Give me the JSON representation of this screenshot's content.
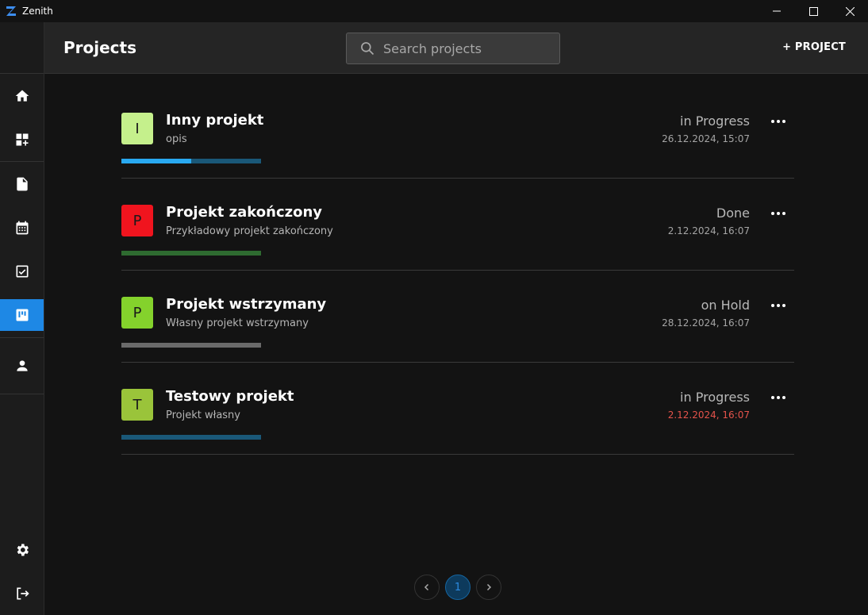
{
  "window": {
    "title": "Zenith"
  },
  "header": {
    "title": "Projects",
    "search_placeholder": "Search projects",
    "add_project_label": "+ PROJECT"
  },
  "sidebar": {
    "items": [
      {
        "name": "home",
        "icon": "home-icon"
      },
      {
        "name": "dashboard-add",
        "icon": "dashboard-add-icon"
      },
      {
        "name": "documents",
        "icon": "document-icon"
      },
      {
        "name": "calendar",
        "icon": "calendar-icon"
      },
      {
        "name": "tasks",
        "icon": "checkbox-icon"
      },
      {
        "name": "projects",
        "icon": "kanban-icon",
        "active": true
      },
      {
        "name": "profile",
        "icon": "person-icon"
      },
      {
        "name": "settings",
        "icon": "gear-icon"
      },
      {
        "name": "logout",
        "icon": "logout-icon"
      }
    ]
  },
  "projects": [
    {
      "initial": "I",
      "avatar_color": "#c5f08c",
      "name": "Inny projekt",
      "description": "opis",
      "status": "in Progress",
      "date": "26.12.2024, 15:07",
      "date_overdue": false,
      "progress": 0.5,
      "progress_color": "#29a9f0",
      "progress_track": "#1a5878"
    },
    {
      "initial": "P",
      "avatar_color": "#f0141e",
      "name": "Projekt zakończony",
      "description": "Przykładowy projekt zakończony",
      "status": "Done",
      "date": "2.12.2024, 16:07",
      "date_overdue": false,
      "progress": 1.0,
      "progress_color": "#2e6b30",
      "progress_track": "#2e6b30"
    },
    {
      "initial": "P",
      "avatar_color": "#84d22c",
      "name": "Projekt wstrzymany",
      "description": "Własny projekt wstrzymany",
      "status": "on Hold",
      "date": "28.12.2024, 16:07",
      "date_overdue": false,
      "progress": 1.0,
      "progress_color": "#6a6a6a",
      "progress_track": "#6a6a6a"
    },
    {
      "initial": "T",
      "avatar_color": "#9ac43a",
      "name": "Testowy projekt",
      "description": "Projekt własny",
      "status": "in Progress",
      "date": "2.12.2024, 16:07",
      "date_overdue": true,
      "progress": 0.0,
      "progress_color": "#29a9f0",
      "progress_track": "#1a5878"
    }
  ],
  "pagination": {
    "current_page": "1",
    "prev_icon": "chevron-left-icon",
    "next_icon": "chevron-right-icon"
  },
  "colors": {
    "accent": "#1e88e5",
    "overdue": "#e5534b"
  }
}
